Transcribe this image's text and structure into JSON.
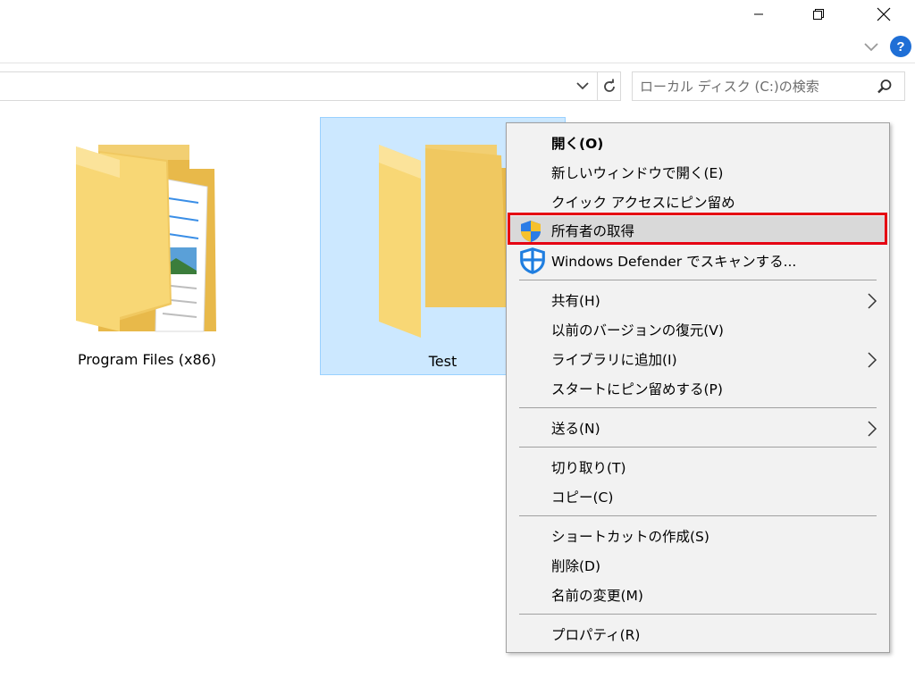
{
  "window": {
    "caption_buttons": [
      "minimize",
      "restore",
      "close"
    ]
  },
  "ribbon": {
    "help_label": "?"
  },
  "search": {
    "placeholder": "ローカル ディスク (C:)の検索"
  },
  "folders": [
    {
      "label": "Program Files (x86)"
    },
    {
      "label": "Test"
    }
  ],
  "context_menu": {
    "items": [
      {
        "label": "開く(O)",
        "bold": true
      },
      {
        "label": "新しいウィンドウで開く(E)"
      },
      {
        "label": "クイック アクセスにピン留め"
      },
      {
        "label": "所有者の取得",
        "icon": "uac-shield-icon",
        "highlighted": true
      },
      {
        "label": "Windows Defender でスキャンする...",
        "icon": "defender-icon"
      },
      {
        "label": "共有(H)",
        "submenu": true
      },
      {
        "label": "以前のバージョンの復元(V)"
      },
      {
        "label": "ライブラリに追加(I)",
        "submenu": true
      },
      {
        "label": "スタートにピン留めする(P)"
      },
      {
        "label": "送る(N)",
        "submenu": true
      },
      {
        "label": "切り取り(T)"
      },
      {
        "label": "コピー(C)"
      },
      {
        "label": "ショートカットの作成(S)"
      },
      {
        "label": "削除(D)"
      },
      {
        "label": "名前の変更(M)"
      },
      {
        "label": "プロパティ(R)"
      }
    ]
  },
  "colors": {
    "selection_bg": "#cce8ff",
    "selection_border": "#99d1ff",
    "highlight_border": "#e50012",
    "menu_bg": "#f2f2f2",
    "help_blue": "#1f6fd6",
    "folder_yellow": "#f8d775"
  }
}
